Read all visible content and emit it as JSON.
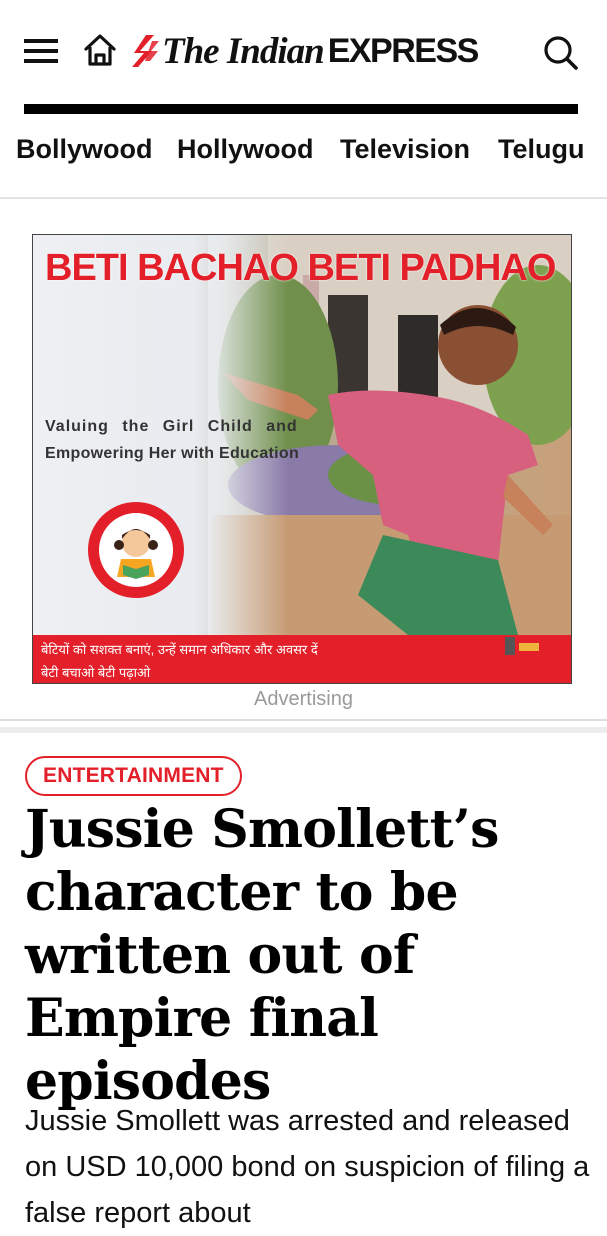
{
  "header": {
    "logo_the": "The Indian",
    "logo_express": "EXPRESS",
    "icons": {
      "menu": "hamburger-menu-icon",
      "home": "home-icon",
      "search": "search-icon"
    }
  },
  "nav": {
    "items": [
      {
        "label": "Bollywood"
      },
      {
        "label": "Hollywood"
      },
      {
        "label": "Television"
      },
      {
        "label": "Telugu"
      }
    ]
  },
  "ad": {
    "headline": "BETI BACHAO BETI PADHAO",
    "tagline_1": "Valuing the Girl Child and",
    "tagline_2": "Empowering Her with Education",
    "hindi_line_1": "बेटियों को सशक्त बनाएं, उन्हें समान अधिकार और अवसर दें",
    "hindi_line_2": "बेटी बचाओ बेटी पढ़ाओ",
    "label": "Advertising"
  },
  "article": {
    "section": "ENTERTAINMENT",
    "headline": "Jussie Smollett’s character to be written out of Empire final episodes",
    "summary": "Jussie Smollett was arrested and released on USD 10,000 bond on suspicion of filing a false report about"
  },
  "colors": {
    "brand_red": "#e3202a",
    "text": "#111111",
    "muted": "#9a9a9a"
  }
}
